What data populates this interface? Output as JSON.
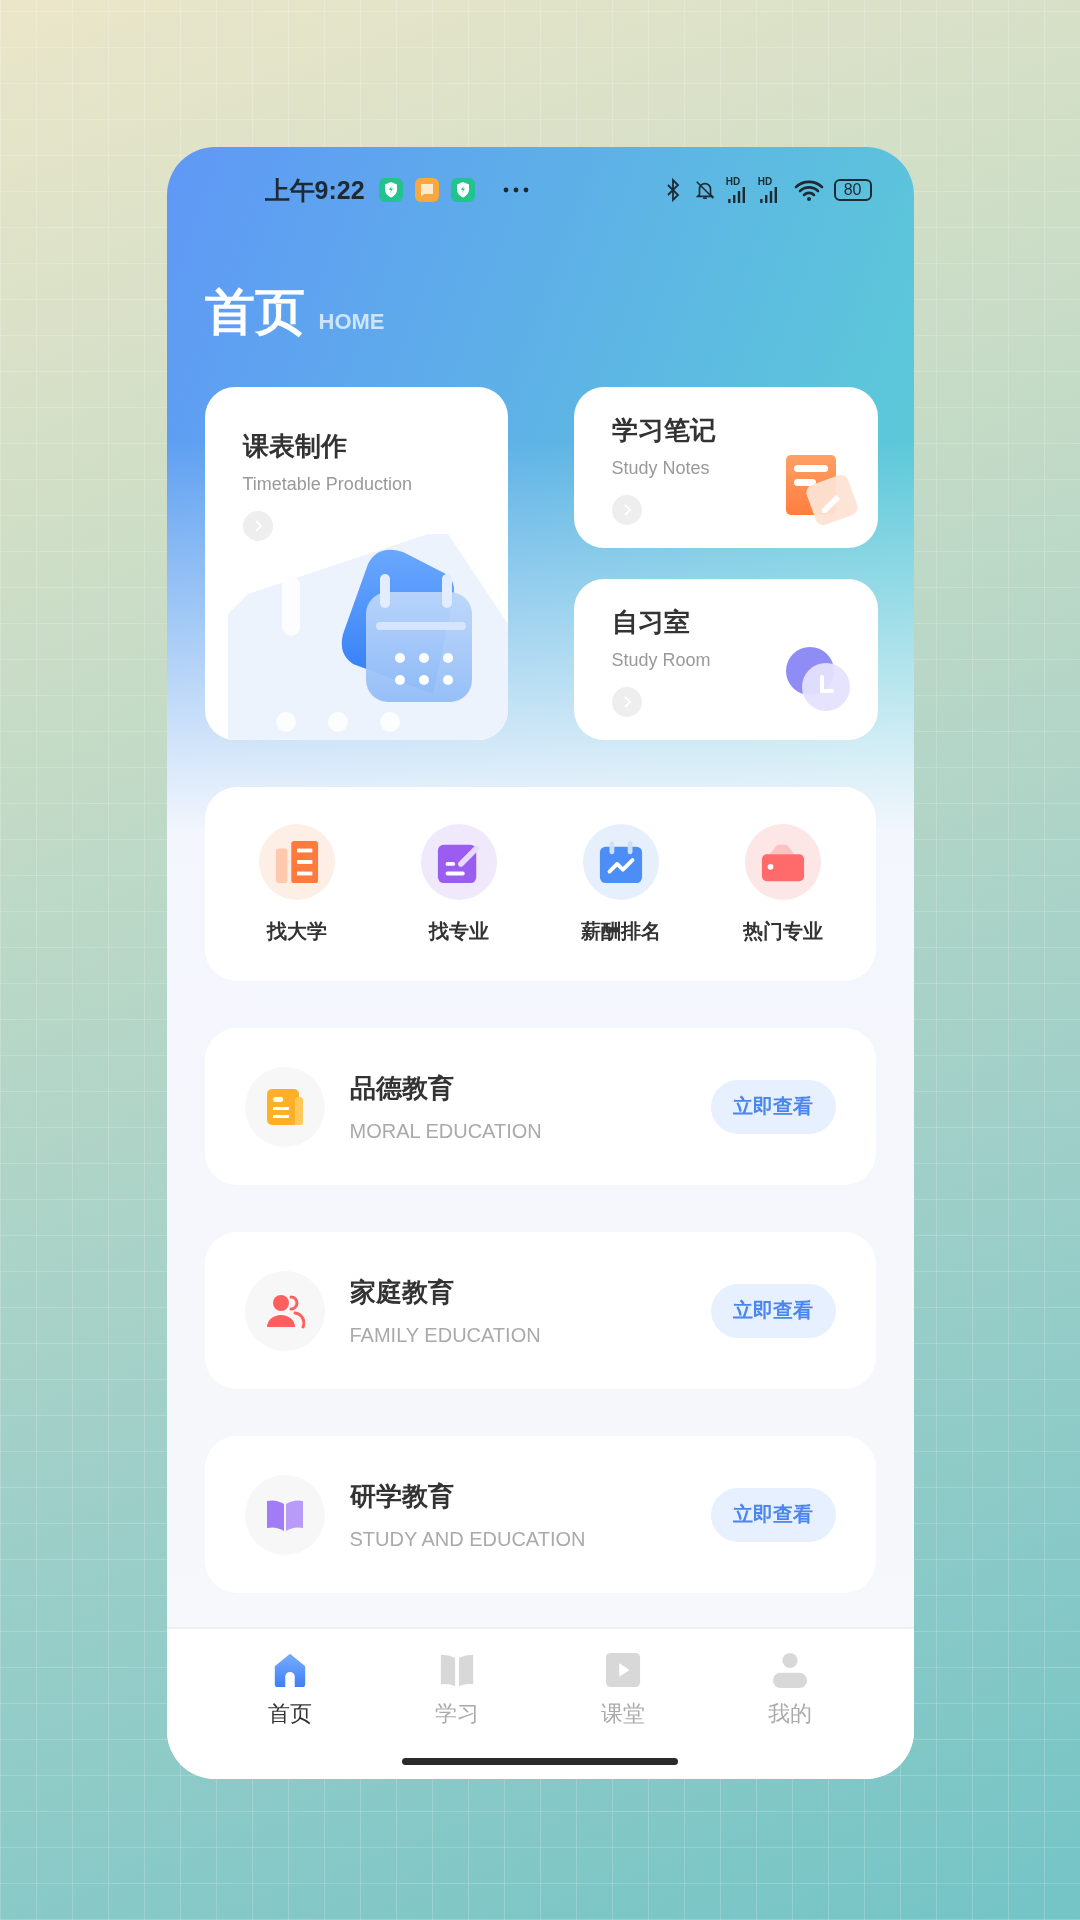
{
  "status_bar": {
    "time": "上午9:22",
    "network_labels": [
      "HD",
      "HD"
    ],
    "battery": "80"
  },
  "header": {
    "title": "首页",
    "subtitle": "HOME"
  },
  "feature_cards": [
    {
      "title": "课表制作",
      "subtitle": "Timetable Production",
      "kind": "timetable"
    },
    {
      "title": "学习笔记",
      "subtitle": "Study Notes",
      "kind": "notes"
    },
    {
      "title": "自习室",
      "subtitle": "Study Room",
      "kind": "room"
    }
  ],
  "shortcuts": [
    {
      "label": "找大学",
      "kind": "university"
    },
    {
      "label": "找专业",
      "kind": "major"
    },
    {
      "label": "薪酬排名",
      "kind": "salary"
    },
    {
      "label": "热门专业",
      "kind": "hot"
    }
  ],
  "topics": [
    {
      "title": "品德教育",
      "subtitle": "MORAL EDUCATION",
      "action": "立即查看",
      "kind": "moral"
    },
    {
      "title": "家庭教育",
      "subtitle": "FAMILY EDUCATION",
      "action": "立即查看",
      "kind": "family"
    },
    {
      "title": "研学教育",
      "subtitle": "STUDY AND EDUCATION",
      "action": "立即查看",
      "kind": "study"
    }
  ],
  "tab_bar": [
    {
      "label": "首页",
      "selected": true,
      "kind": "home"
    },
    {
      "label": "学习",
      "selected": false,
      "kind": "learn"
    },
    {
      "label": "课堂",
      "selected": false,
      "kind": "class"
    },
    {
      "label": "我的",
      "selected": false,
      "kind": "me"
    }
  ]
}
